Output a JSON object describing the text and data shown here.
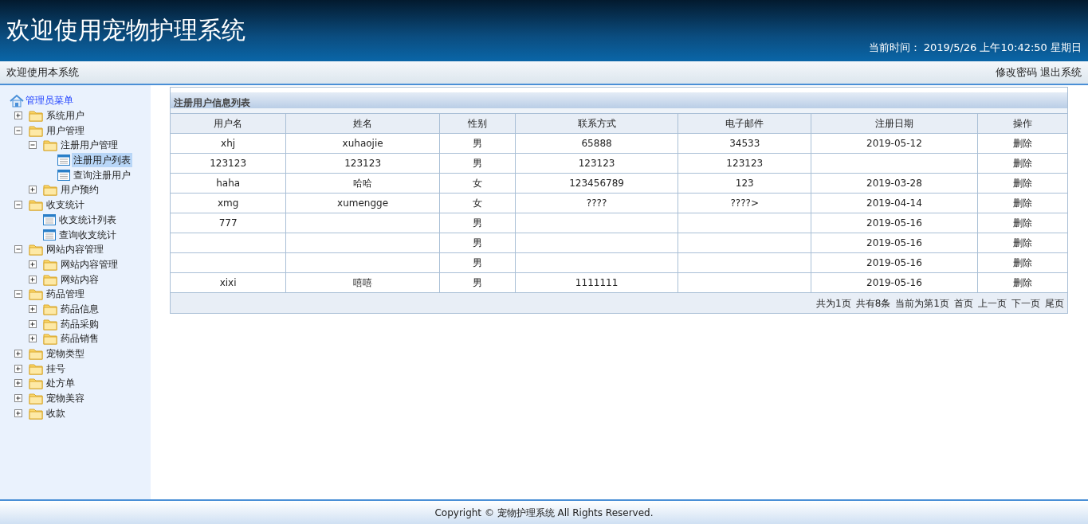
{
  "header": {
    "title": "欢迎使用宠物护理系统",
    "time_label": "当前时间：",
    "time_value": "2019/5/26 上午10:42:50 星期日"
  },
  "top_bar": {
    "welcome": "欢迎使用本系统",
    "links": [
      "修改密码",
      "退出系统"
    ]
  },
  "sidebar": {
    "root": "管理员菜单",
    "items": [
      {
        "label": "系统用户",
        "kind": "folder",
        "expanded": false,
        "selected": false
      },
      {
        "label": "用户管理",
        "kind": "folder",
        "expanded": true,
        "selected": false,
        "children": [
          {
            "label": "注册用户管理",
            "kind": "folder",
            "expanded": true,
            "selected": false,
            "children": [
              {
                "label": "注册用户列表",
                "kind": "page",
                "selected": true
              },
              {
                "label": "查询注册用户",
                "kind": "page",
                "selected": false
              }
            ]
          },
          {
            "label": "用户预约",
            "kind": "folder",
            "expanded": false,
            "selected": false
          }
        ]
      },
      {
        "label": "收支统计",
        "kind": "folder",
        "expanded": true,
        "selected": false,
        "children": [
          {
            "label": "收支统计列表",
            "kind": "page",
            "selected": false
          },
          {
            "label": "查询收支统计",
            "kind": "page",
            "selected": false
          }
        ]
      },
      {
        "label": "网站内容管理",
        "kind": "folder",
        "expanded": true,
        "selected": false,
        "children": [
          {
            "label": "网站内容管理",
            "kind": "folder",
            "expanded": false,
            "selected": false
          },
          {
            "label": "网站内容",
            "kind": "folder",
            "expanded": false,
            "selected": false
          }
        ]
      },
      {
        "label": "药品管理",
        "kind": "folder",
        "expanded": true,
        "selected": false,
        "children": [
          {
            "label": "药品信息",
            "kind": "folder",
            "expanded": false,
            "selected": false
          },
          {
            "label": "药品采购",
            "kind": "folder",
            "expanded": false,
            "selected": false
          },
          {
            "label": "药品销售",
            "kind": "folder",
            "expanded": false,
            "selected": false
          }
        ]
      },
      {
        "label": "宠物类型",
        "kind": "folder",
        "expanded": false,
        "selected": false
      },
      {
        "label": "挂号",
        "kind": "folder",
        "expanded": false,
        "selected": false
      },
      {
        "label": "处方单",
        "kind": "folder",
        "expanded": false,
        "selected": false
      },
      {
        "label": "宠物美容",
        "kind": "folder",
        "expanded": false,
        "selected": false
      },
      {
        "label": "收款",
        "kind": "folder",
        "expanded": false,
        "selected": false
      }
    ]
  },
  "panel": {
    "title": "注册用户信息列表",
    "table": {
      "columns": [
        "用户名",
        "姓名",
        "性别",
        "联系方式",
        "电子邮件",
        "注册日期",
        "操作"
      ],
      "rows": [
        {
          "cells": [
            "xhj",
            "xuhaojie",
            "男",
            "65888",
            "34533",
            "2019-05-12"
          ],
          "action": "删除"
        },
        {
          "cells": [
            "123123",
            "123123",
            "男",
            "123123",
            "123123",
            ""
          ],
          "action": "删除"
        },
        {
          "cells": [
            "haha",
            "哈哈",
            "女",
            "123456789",
            "123",
            "2019-03-28"
          ],
          "action": "删除"
        },
        {
          "cells": [
            "xmg",
            "xumengge",
            "女",
            "????",
            "????>",
            "2019-04-14"
          ],
          "action": "删除"
        },
        {
          "cells": [
            "777",
            "",
            "男",
            "",
            "",
            "2019-05-16"
          ],
          "action": "删除"
        },
        {
          "cells": [
            "",
            "",
            "男",
            "",
            "",
            "2019-05-16"
          ],
          "action": "删除"
        },
        {
          "cells": [
            "",
            "",
            "男",
            "",
            "",
            "2019-05-16"
          ],
          "action": "删除"
        },
        {
          "cells": [
            "xixi",
            "嘻嘻",
            "男",
            "1111111",
            "",
            "2019-05-16"
          ],
          "action": "删除"
        }
      ]
    },
    "pager": {
      "info": [
        "共为1页",
        "共有8条",
        "当前为第1页"
      ],
      "links": [
        "首页",
        "上一页",
        "下一页",
        "尾页"
      ]
    }
  },
  "footer": "Copyright © 宠物护理系统 All Rights Reserved."
}
